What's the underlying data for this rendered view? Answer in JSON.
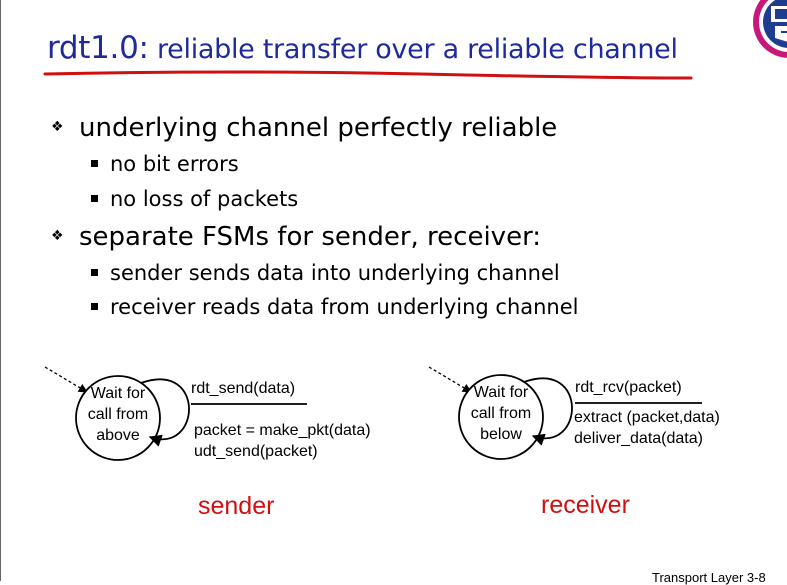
{
  "slide": {
    "title_prefix": "rdt1.0:",
    "title_main": " reliable transfer over a reliable channel",
    "footer": "Transport Layer 3-8"
  },
  "bullets": [
    {
      "text": "underlying channel perfectly reliable",
      "sub": [
        "no bit errors",
        "no loss of packets"
      ]
    },
    {
      "text": "separate FSMs for sender, receiver:",
      "sub": [
        "sender sends data into underlying channel",
        "receiver reads data from underlying channel"
      ]
    }
  ],
  "sender_fsm": {
    "state_lines": [
      "Wait for",
      "call from",
      "above"
    ],
    "event": "rdt_send(data)",
    "actions": [
      "packet = make_pkt(data)",
      "udt_send(packet)"
    ],
    "caption": "sender"
  },
  "receiver_fsm": {
    "state_lines": [
      "Wait for",
      "call from",
      "below"
    ],
    "event": "rdt_rcv(packet)",
    "actions": [
      "extract (packet,data)",
      "deliver_data(data)"
    ],
    "caption": "receiver"
  },
  "colors": {
    "title": "#1f2a9c",
    "underline": "#d01010",
    "caption": "#d01010"
  },
  "icons": {
    "bullet_l1": "diamond-bullet-icon",
    "bullet_l2": "square-bullet-icon",
    "logo": "university-seal-icon"
  }
}
